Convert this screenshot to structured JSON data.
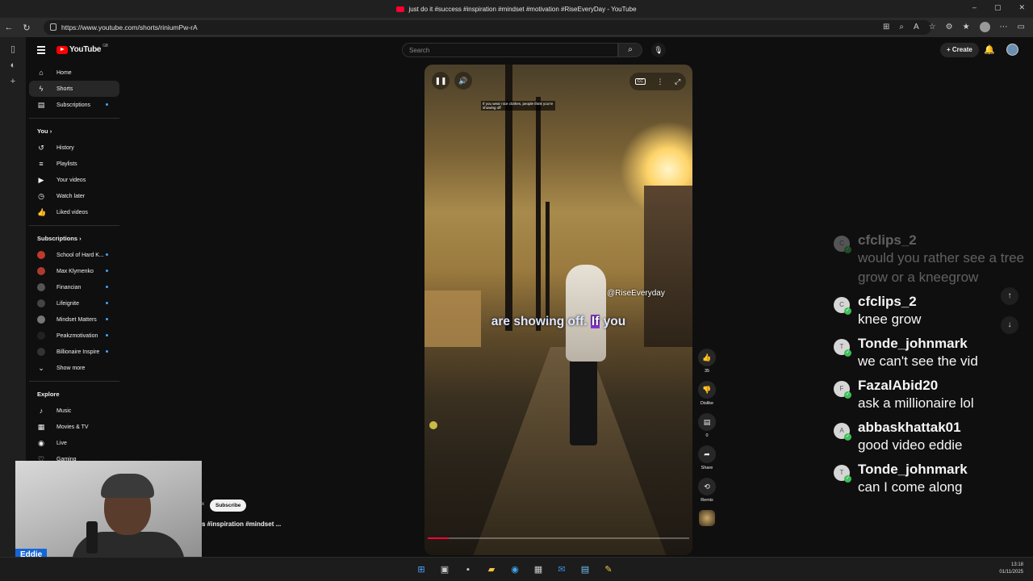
{
  "browser": {
    "window_title": "just do it #success #inspiration #mindset #motivation #RiseEveryDay - YouTube",
    "url": "https://www.youtube.com/shorts/riniumPw-rA",
    "window_controls": [
      "–",
      "▢",
      "✕"
    ]
  },
  "header": {
    "logo_text": "YouTube",
    "logo_region": "GB",
    "search_placeholder": "Search",
    "create_label": "Create"
  },
  "sidebar": {
    "main": [
      {
        "label": "Home",
        "icon": "home-icon"
      },
      {
        "label": "Shorts",
        "icon": "shorts-icon",
        "active": true
      },
      {
        "label": "Subscriptions",
        "icon": "subscriptions-icon",
        "dot": true
      }
    ],
    "you_heading": "You",
    "you_items": [
      {
        "label": "History",
        "icon": "history-icon"
      },
      {
        "label": "Playlists",
        "icon": "playlists-icon"
      },
      {
        "label": "Your videos",
        "icon": "your-videos-icon"
      },
      {
        "label": "Watch later",
        "icon": "watch-later-icon"
      },
      {
        "label": "Liked videos",
        "icon": "liked-videos-icon"
      }
    ],
    "subs_heading": "Subscriptions",
    "subscriptions": [
      {
        "label": "School of Hard K...",
        "color": "#c0392b"
      },
      {
        "label": "Max Klymenko",
        "color": "#b03a2e"
      },
      {
        "label": "Financian",
        "color": "#555555"
      },
      {
        "label": "Lifeignite",
        "color": "#444444"
      },
      {
        "label": "Mindset Matters",
        "color": "#777777"
      },
      {
        "label": "Peakzmotivation",
        "color": "#222222"
      },
      {
        "label": "Billionaire Inspire",
        "color": "#333333"
      }
    ],
    "show_more": "Show more",
    "explore_heading": "Explore",
    "explore": [
      {
        "label": "Music",
        "icon": "music-icon"
      },
      {
        "label": "Movies & TV",
        "icon": "movies-icon"
      },
      {
        "label": "Live",
        "icon": "live-icon"
      },
      {
        "label": "Gaming",
        "icon": "gaming-icon"
      }
    ]
  },
  "video": {
    "small_overlay": "If you wear nice clothes, people think you're showing off",
    "watermark": "@RiseEveryday",
    "caption_pre": "are showing off. ",
    "caption_highlight": "If",
    "caption_post": " you",
    "progress": 0.08
  },
  "actions": {
    "likes": "35",
    "dislike": "Dislike",
    "comments": "0",
    "share": "Share",
    "remix": "Remix"
  },
  "channel": {
    "subscribe": "Subscribe",
    "title_fragment": "s #inspiration #mindset ...",
    "prefix": "x"
  },
  "webcam": {
    "name": "Eddie"
  },
  "chat": {
    "messages": [
      {
        "user": "cfclips_2",
        "text": "would you rather see a tree grow or a kneegrow",
        "initial": "C",
        "faded": true
      },
      {
        "user": "cfclips_2",
        "text": "knee grow",
        "initial": "C"
      },
      {
        "user": "Tonde_johnmark",
        "text": "we can't see the vid",
        "initial": "T"
      },
      {
        "user": "FazalAbid20",
        "text": "ask a millionaire lol",
        "initial": "F"
      },
      {
        "user": "abbaskhattak01",
        "text": "good video eddie",
        "initial": "A"
      },
      {
        "user": "Tonde_johnmark",
        "text": "can I come along",
        "initial": "T"
      }
    ]
  },
  "taskbar": {
    "time": "13:18",
    "date": "01/11/2025"
  }
}
